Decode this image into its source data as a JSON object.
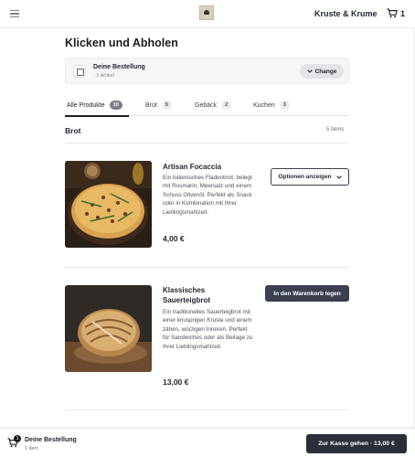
{
  "header": {
    "brand": "Kruste & Krume",
    "cart_count": "1",
    "icons": {
      "menu": "hamburger-icon",
      "logo": "bakery-logo",
      "cart": "cart-icon"
    }
  },
  "page": {
    "title": "Klicken und Abholen"
  },
  "order": {
    "title": "Deine Bestellung",
    "subtitle": "· 1 Artikel",
    "change_label": "Change"
  },
  "tabs": [
    {
      "label": "Alle Produkte",
      "count": "10",
      "active": true
    },
    {
      "label": "Brot",
      "count": "5",
      "active": false
    },
    {
      "label": "Gebäck",
      "count": "2",
      "active": false
    },
    {
      "label": "Kuchen",
      "count": "3",
      "active": false
    }
  ],
  "section": {
    "title": "Brot",
    "count": "5 items"
  },
  "products": [
    {
      "name": "Artisan Focaccia",
      "description": "Ein italienisches Fladenbrot, belegt mit Rosmarin, Meersalz und einem Schuss Olivenöl. Perfekt als Snack oder in Kombination mit Ihrer Lieblingsmahlzeit.",
      "price": "4,00 €",
      "action_label": "Optionen anzeigen"
    },
    {
      "name": "Klassisches Sauerteigbrot",
      "description": "Ein traditionelles Sauerteigbrot mit einer knusprigen Kruste und einem zähen, würzigen Inneren. Perfekt für Sandwiches oder als Beilage zu Ihrer Lieblingsmahlzeit.",
      "price": "13,00 €",
      "action_label": "In den Warenkorb legen"
    }
  ],
  "bottom_bar": {
    "badge": "1",
    "title": "Deine Bestellung",
    "subtitle": "1 item",
    "checkout_label": "Zur Kasse gehen · 13,00 €"
  },
  "colors": {
    "primary": "#2b2f3a",
    "accent_button": "#3b4050",
    "muted": "#f6f6f8"
  }
}
